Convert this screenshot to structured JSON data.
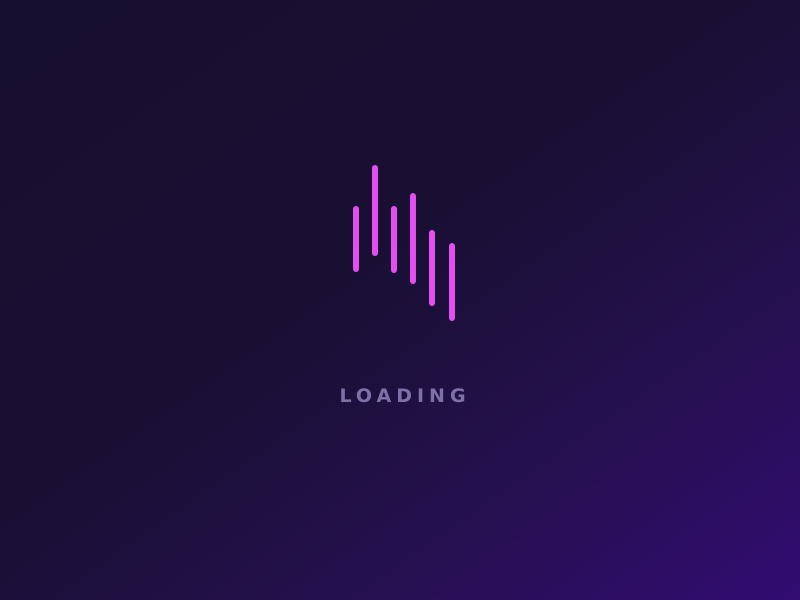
{
  "loading": {
    "label": "LOADING",
    "icon": "audio-bars-icon",
    "accent_color": "#e24ef0",
    "text_color": "#7e71a8",
    "background_colors": [
      "#170f2f",
      "#320c72"
    ]
  }
}
